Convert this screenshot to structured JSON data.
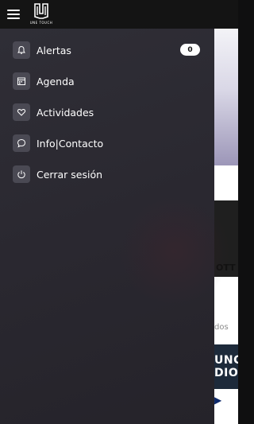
{
  "app": {
    "logo_text": "UNE TOUCH"
  },
  "drawer": {
    "items": [
      {
        "label": "Alertas",
        "icon": "bell-icon"
      },
      {
        "label": "Agenda",
        "icon": "calendar-icon"
      },
      {
        "label": "Actividades",
        "icon": "heart-icon"
      },
      {
        "label": "Info|Contacto",
        "icon": "chat-icon"
      },
      {
        "label": "Cerrar sesión",
        "icon": "power-icon"
      }
    ],
    "alerts_count": "0"
  },
  "background": {
    "partial_title": "OTT",
    "partial_gray": "dos",
    "banner_line1": "UNCI",
    "banner_line2": "DIO"
  }
}
